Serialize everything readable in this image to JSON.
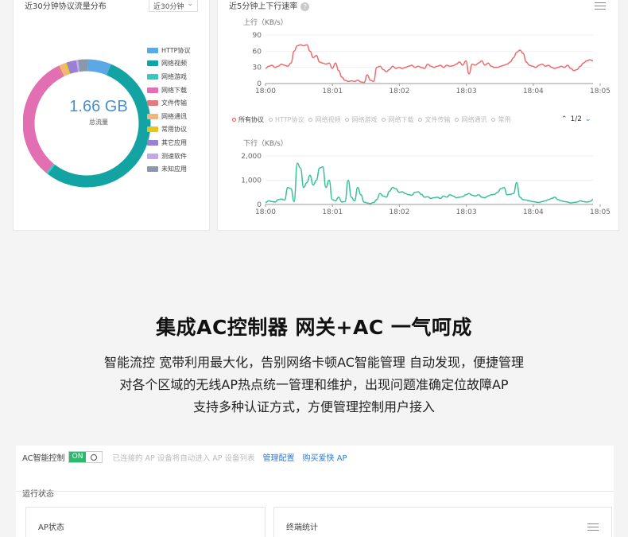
{
  "protocol_panel": {
    "title": "近30分钟协议流量分布",
    "range": "近30分钟",
    "total_value": "1.66 GB",
    "total_label": "总流量",
    "legend": [
      {
        "label": "HTTP协议",
        "color": "#5aa9e6"
      },
      {
        "label": "网络视频",
        "color": "#14a3a3"
      },
      {
        "label": "网络游戏",
        "color": "#35c9c0"
      },
      {
        "label": "网络下载",
        "color": "#e26fb2"
      },
      {
        "label": "文件传输",
        "color": "#e07b7b"
      },
      {
        "label": "网络通讯",
        "color": "#f5b57a"
      },
      {
        "label": "常用协议",
        "color": "#e6c619"
      },
      {
        "label": "其它应用",
        "color": "#9b7fd0"
      },
      {
        "label": "测速软件",
        "color": "#c3a8e6"
      },
      {
        "label": "未知应用",
        "color": "#8a98ab"
      }
    ]
  },
  "rate_panel": {
    "title": "近5分钟上下行速率",
    "series_legend": [
      "所有协议",
      "HTTP协议",
      "网络视频",
      "网络游戏",
      "网络下载",
      "文件传输",
      "网络通讯",
      "常用"
    ],
    "pager": "1/2"
  },
  "chart_data": [
    {
      "type": "pie",
      "categories": [
        "HTTP协议",
        "网络视频",
        "网络游戏",
        "网络下载",
        "文件传输",
        "网络通讯",
        "常用协议",
        "其它应用",
        "测速软件",
        "未知应用"
      ],
      "values": [
        6,
        55,
        0.5,
        32,
        0.5,
        1.5,
        0.5,
        2.5,
        0.5,
        2.5
      ],
      "colors": [
        "#5aa9e6",
        "#14a3a3",
        "#35c9c0",
        "#e26fb2",
        "#e07b7b",
        "#f5b57a",
        "#e6c619",
        "#9b7fd0",
        "#c3a8e6",
        "#8a98ab"
      ],
      "center_value": "1.66 GB",
      "center_label": "总流量"
    },
    {
      "type": "line",
      "ylabel": "上行（KB/s）",
      "ylim": [
        0,
        90
      ],
      "yticks": [
        0,
        30,
        60,
        90
      ],
      "xticks": [
        "18:00",
        "18:01",
        "18:02",
        "18:03",
        "18:04",
        "18:05"
      ],
      "color": "#ef6b6b",
      "series": [
        {
          "x": [
            0,
            4,
            8,
            12,
            16,
            20,
            24,
            28,
            32,
            36,
            40,
            44,
            48,
            52,
            56,
            60,
            64,
            68,
            72,
            76,
            80,
            84,
            88,
            92,
            96,
            100,
            104,
            108,
            112,
            116,
            120,
            124,
            128,
            132,
            136,
            140,
            144,
            148,
            152,
            156,
            160,
            164,
            168,
            172,
            176,
            180,
            184,
            188,
            192,
            196,
            200,
            204,
            208,
            212,
            216,
            220,
            224,
            228,
            232,
            236,
            240,
            244,
            248,
            252,
            256,
            260,
            264,
            268,
            272,
            276,
            280,
            284,
            288,
            292,
            296,
            300,
            304,
            308,
            312,
            316,
            320,
            324,
            328,
            332,
            336,
            340,
            344,
            348,
            352,
            356,
            360,
            364,
            368,
            372,
            376,
            380,
            384,
            388,
            392,
            396,
            400,
            404,
            408,
            412
          ],
          "values": [
            28,
            32,
            34,
            30,
            32,
            36,
            34,
            32,
            38,
            60,
            70,
            72,
            70,
            72,
            60,
            48,
            52,
            40,
            38,
            36,
            38,
            28,
            38,
            24,
            12,
            6,
            4,
            5,
            4,
            6,
            3,
            2,
            16,
            6,
            4,
            30,
            32,
            26,
            22,
            26,
            32,
            28,
            30,
            28,
            30,
            32,
            34,
            30,
            32,
            30,
            28,
            36,
            32,
            30,
            32,
            34,
            30,
            34,
            32,
            33,
            36,
            40,
            34,
            42,
            18,
            36,
            34,
            38,
            42,
            34,
            38,
            32,
            30,
            30,
            32,
            34,
            36,
            40,
            48,
            58,
            62,
            56,
            40,
            34,
            32,
            30,
            34,
            36,
            32,
            34,
            30,
            28,
            30,
            32,
            30,
            34,
            28,
            24,
            26,
            32,
            38,
            42,
            44,
            42
          ]
        }
      ]
    },
    {
      "type": "line",
      "ylabel": "下行（KB/s）",
      "ylim": [
        0,
        2000
      ],
      "yticks": [
        0,
        1000,
        2000
      ],
      "xticks": [
        "18:00",
        "18:01",
        "18:02",
        "18:03",
        "18:04",
        "18:05"
      ],
      "color": "#35c19a",
      "series": [
        {
          "x": [
            0,
            4,
            8,
            12,
            16,
            20,
            24,
            28,
            32,
            36,
            40,
            44,
            48,
            52,
            56,
            60,
            64,
            68,
            72,
            76,
            80,
            84,
            88,
            92,
            96,
            100,
            104,
            108,
            112,
            116,
            120,
            124,
            128,
            132,
            136,
            140,
            144,
            148,
            152,
            156,
            160,
            164,
            168,
            172,
            176,
            180,
            184,
            188,
            192,
            196,
            200,
            204,
            208,
            212,
            216,
            220,
            224,
            228,
            232,
            236,
            240,
            244,
            248,
            252,
            256,
            260,
            264,
            268,
            272,
            276,
            280,
            284,
            288,
            292,
            296,
            300,
            304,
            308,
            312,
            316,
            320,
            324,
            328,
            332,
            336,
            340,
            344,
            348,
            352,
            356,
            360,
            364,
            368,
            372,
            376,
            380,
            384,
            388,
            392,
            396,
            400,
            404,
            408,
            412
          ],
          "values": [
            80,
            150,
            120,
            100,
            200,
            220,
            180,
            700,
            650,
            120,
            1700,
            1500,
            700,
            900,
            1200,
            800,
            1000,
            1500,
            1550,
            700,
            1000,
            200,
            150,
            300,
            100,
            120,
            1000,
            300,
            150,
            700,
            400,
            100,
            60,
            40,
            80,
            200,
            450,
            350,
            300,
            550,
            700,
            650,
            500,
            520,
            450,
            400,
            380,
            500,
            520,
            420,
            300,
            320,
            250,
            280,
            300,
            250,
            350,
            300,
            400,
            350,
            280,
            300,
            320,
            400,
            450,
            380,
            350,
            400,
            300,
            280,
            350,
            400,
            420,
            500,
            650,
            700,
            400,
            420,
            450,
            900,
            300,
            200,
            180,
            150,
            120,
            100,
            80,
            120,
            150,
            200,
            250,
            300,
            200,
            150,
            120,
            100,
            60,
            80,
            100,
            150,
            120,
            100,
            120,
            200
          ]
        }
      ]
    }
  ],
  "headline": "集成AC控制器 网关+AC 一气呵成",
  "description_lines": [
    "智能流控 宽带利用最大化，告别网络卡顿AC智能管理 自动发现，便捷管理",
    "对各个区域的无线AP热点统一管理和维护，出现问题准确定位故障AP",
    "支持多种认证方式，方便管理控制用户接入"
  ],
  "ac_panel": {
    "label": "AC智能控制",
    "toggle_state": "ON",
    "hint": "已连接的 AP 设备将自动进入 AP 设备列表",
    "link_manage": "管理配置",
    "link_buy": "购买爱快 AP",
    "run_status": "运行状态",
    "ap_status": "AP状态",
    "terminal_stats": "终端统计"
  }
}
